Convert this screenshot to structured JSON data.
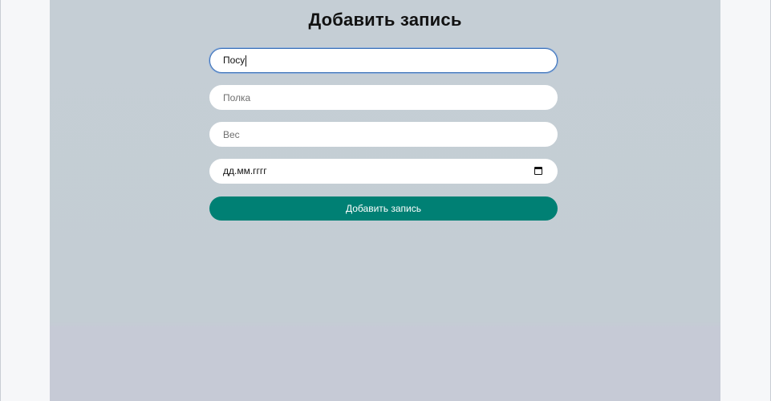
{
  "form": {
    "title": "Добавить запись",
    "name_value": "Посу",
    "shelf_placeholder": "Полка",
    "weight_placeholder": "Вес",
    "date_placeholder": "дд.мм.гггг",
    "submit_label": "Добавить запись"
  },
  "colors": {
    "panel": "#c5ced5",
    "submit": "#008074",
    "focus_border": "#3f73b8"
  },
  "icons": {
    "date_picker": "calendar-icon"
  }
}
